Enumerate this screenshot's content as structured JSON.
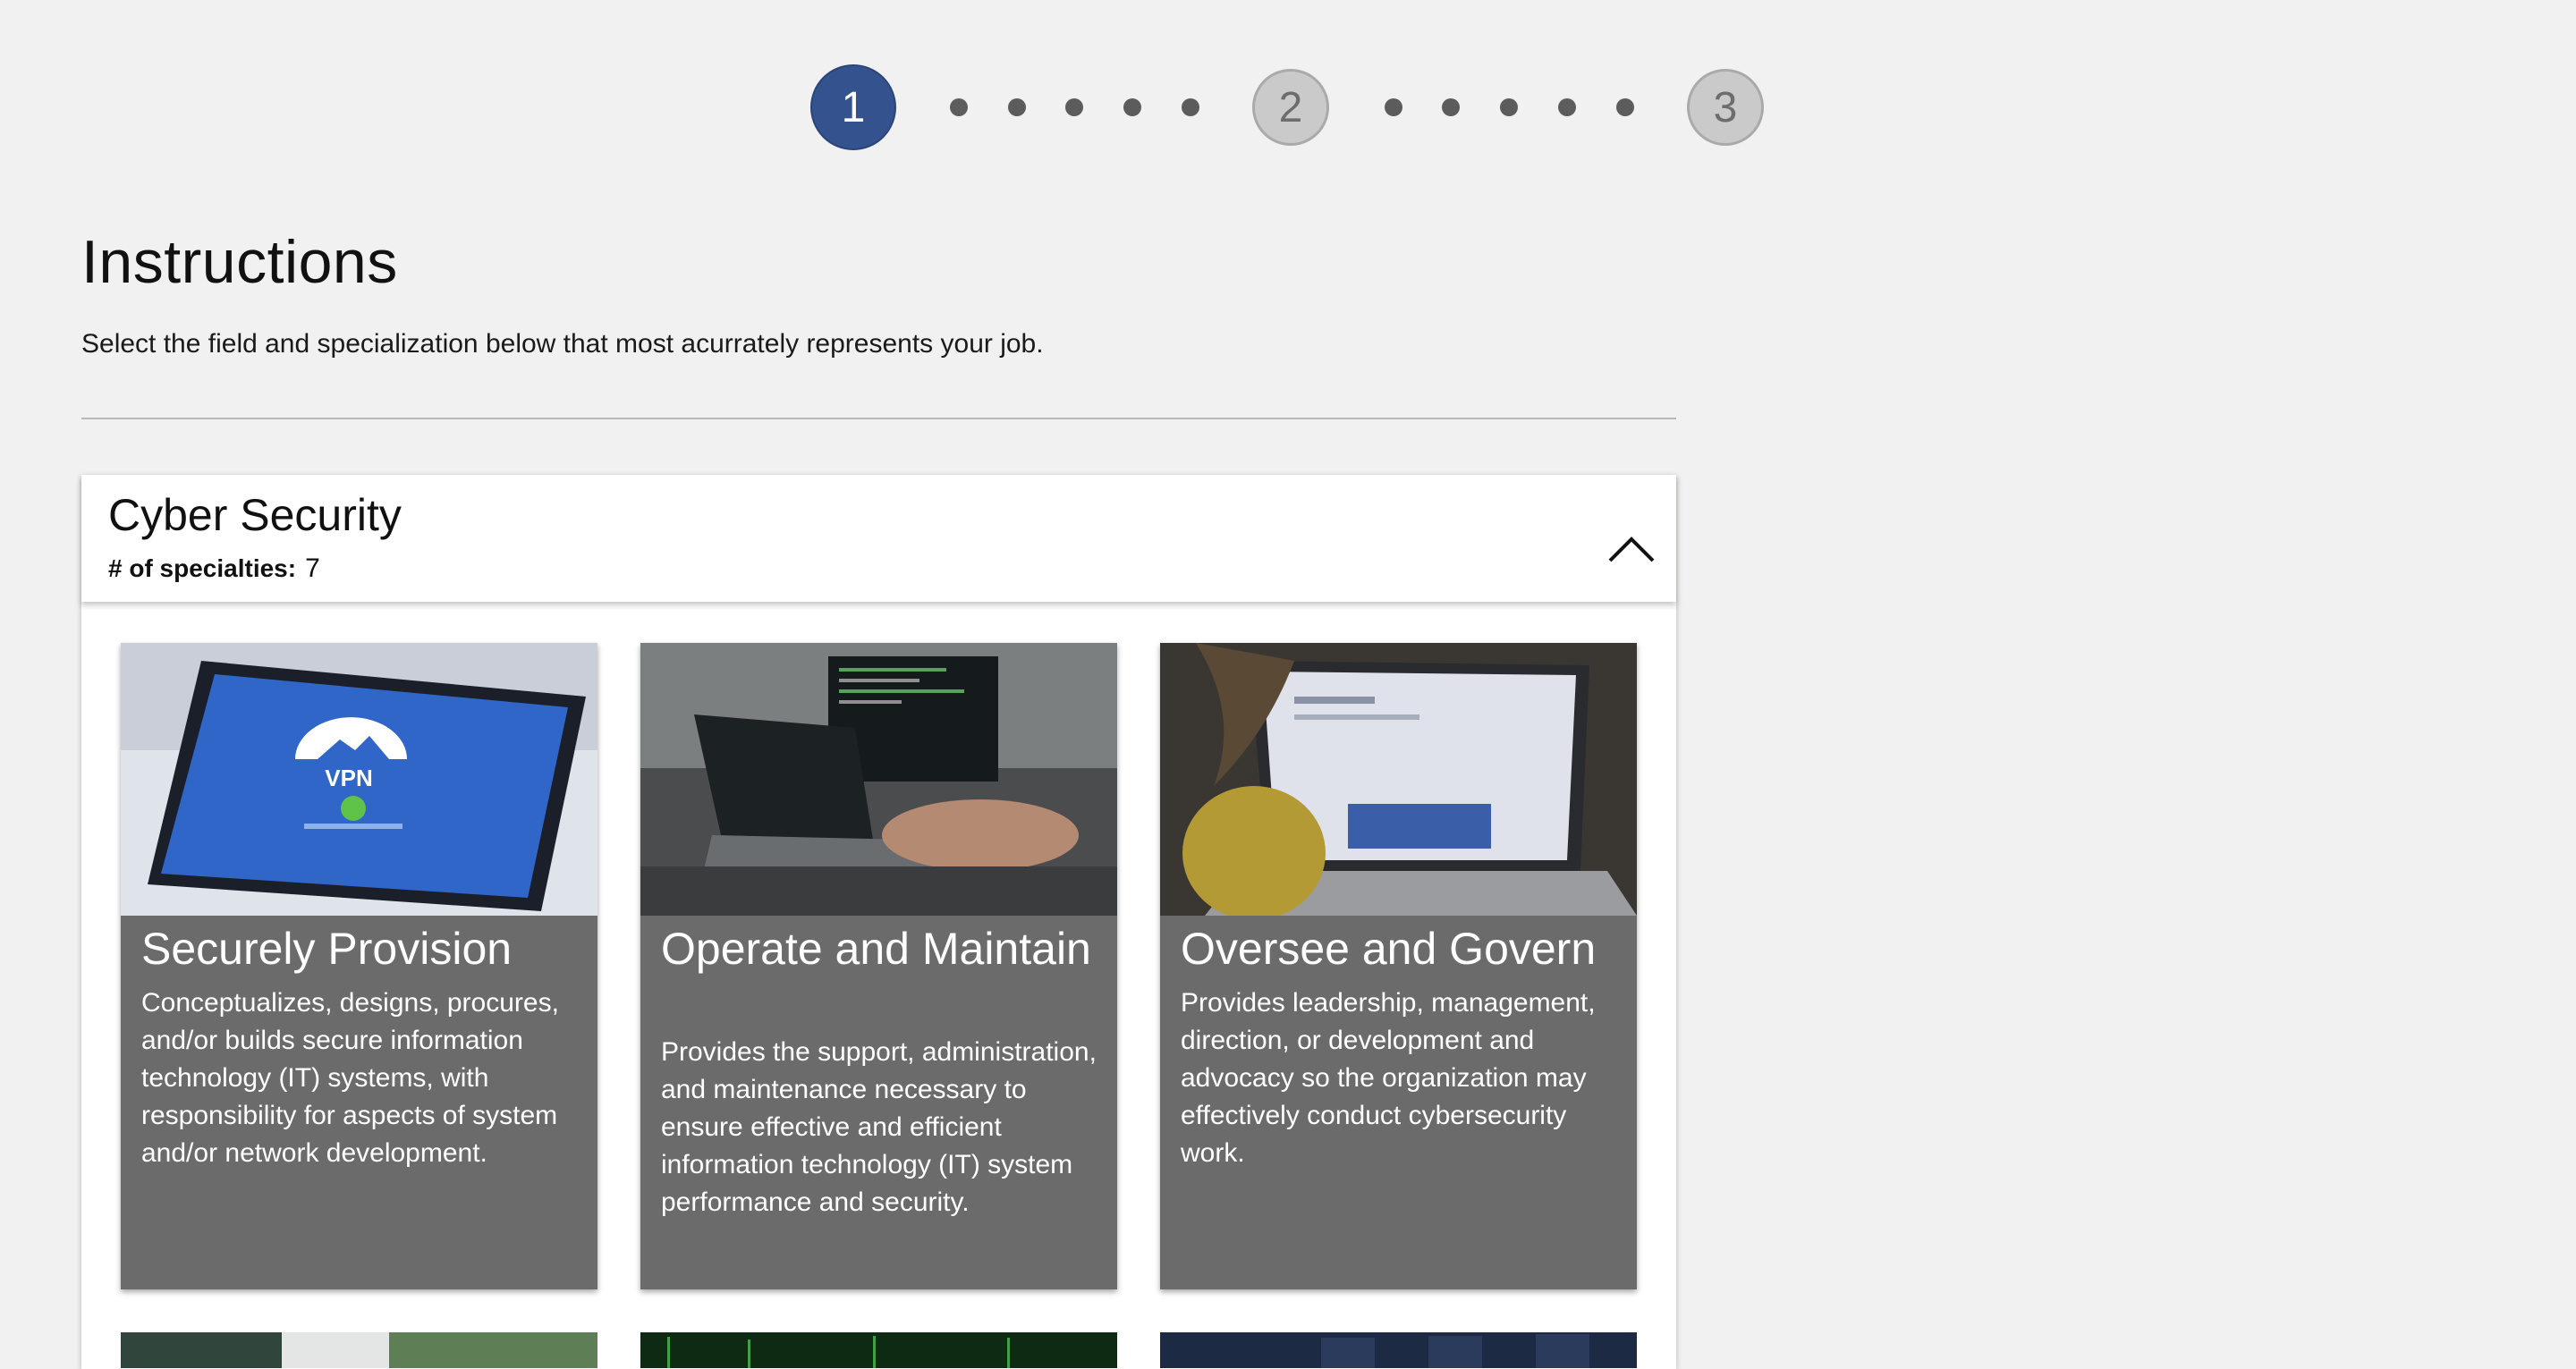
{
  "stepper": {
    "steps": [
      {
        "label": "1",
        "state": "active"
      },
      {
        "label": "2",
        "state": "inactive"
      },
      {
        "label": "3",
        "state": "inactive"
      }
    ],
    "active_color": "#34538e"
  },
  "instructions": {
    "title": "Instructions",
    "subtitle": "Select the field and specialization below that most acurrately represents your job."
  },
  "category": {
    "title": "Cyber Security",
    "specialties_label": "# of specialties:",
    "specialties_count": "7",
    "expanded": true
  },
  "cards": [
    {
      "title": "Securely Provision",
      "description": "Conceptualizes, designs, procures, and/or builds secure information technology (IT) systems, with responsibility for aspects of system and/or network development.",
      "image_text": "VPN"
    },
    {
      "title": "Operate and Maintain",
      "description": "Provides the support, administration, and maintenance necessary to ensure effective and efficient information technology (IT) system performance and security."
    },
    {
      "title": "Oversee and Govern",
      "description": "Provides leadership, management, direction, or development and advocacy so the organization may effectively conduct cybersecurity work."
    }
  ]
}
